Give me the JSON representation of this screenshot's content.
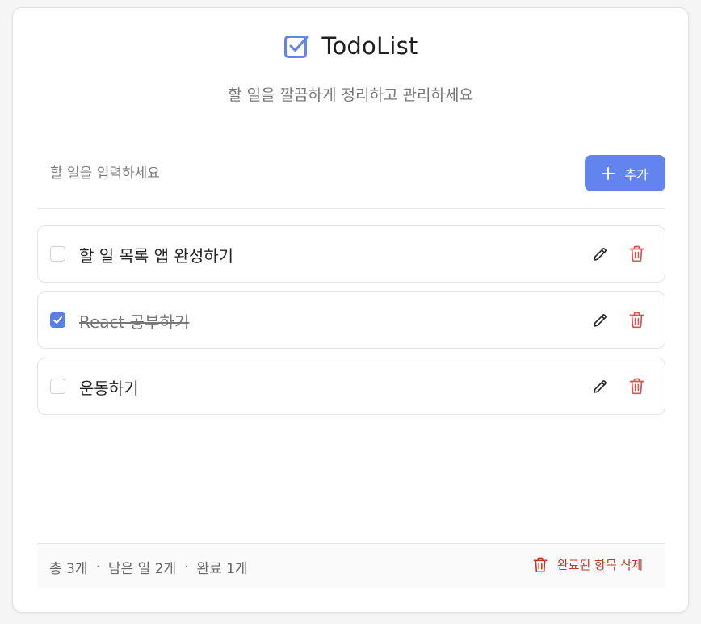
{
  "header": {
    "title": "TodoList",
    "subtitle": "할 일을 깔끔하게 정리하고 관리하세요",
    "icon": "checkbox-icon"
  },
  "input": {
    "placeholder": "할 일을 입력하세요",
    "value": "",
    "add_label": "추가"
  },
  "todos": [
    {
      "text": "할 일 목록 앱 완성하기",
      "completed": false
    },
    {
      "text": "React 공부하기",
      "completed": true
    },
    {
      "text": "운동하기",
      "completed": false
    }
  ],
  "footer": {
    "total": "총 3개",
    "remaining": "남은 일 2개",
    "completed": "완료 1개",
    "separator": "·",
    "clear_label": "완료된 항목 삭제"
  },
  "colors": {
    "accent": "#6384ec",
    "danger": "#c0392b",
    "text": "#222222",
    "muted": "#777777"
  }
}
